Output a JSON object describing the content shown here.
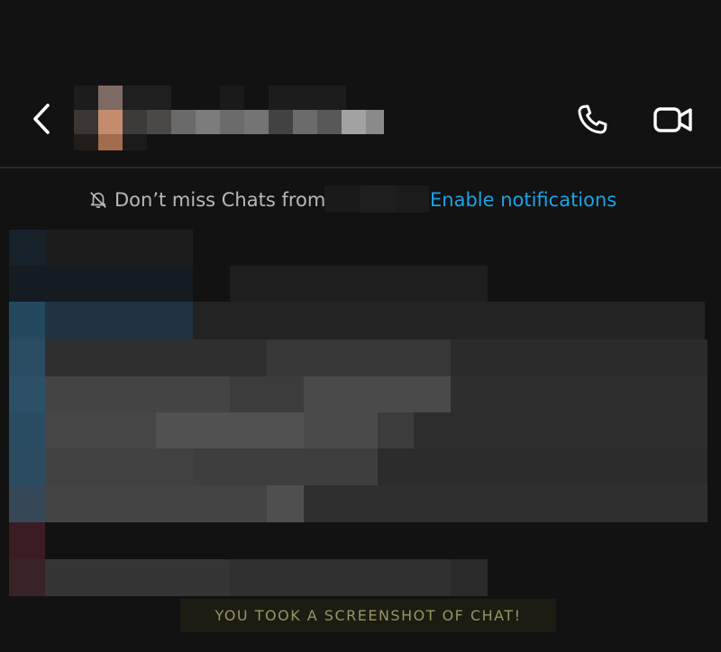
{
  "header": {
    "back_icon": "chevron-left-icon",
    "contact_name_pixelated": true,
    "call_icon": "phone-icon",
    "video_icon": "video-camera-icon"
  },
  "notice": {
    "icon": "bell-slash-icon",
    "text": "Don’t miss Chats from",
    "link_label": "Enable notifications"
  },
  "messages": {
    "content_pixelated": true
  },
  "toast": {
    "text": "YOU TOOK A SCREENSHOT OF CHAT!"
  },
  "colors": {
    "background": "#121212",
    "link": "#1aa3e8",
    "notice_text": "#b8b8b8",
    "toast_text": "#9a9460",
    "toast_bg": "#1c1c12",
    "incoming_bar": "#2a5168",
    "outgoing_bar": "#3a1c22"
  }
}
